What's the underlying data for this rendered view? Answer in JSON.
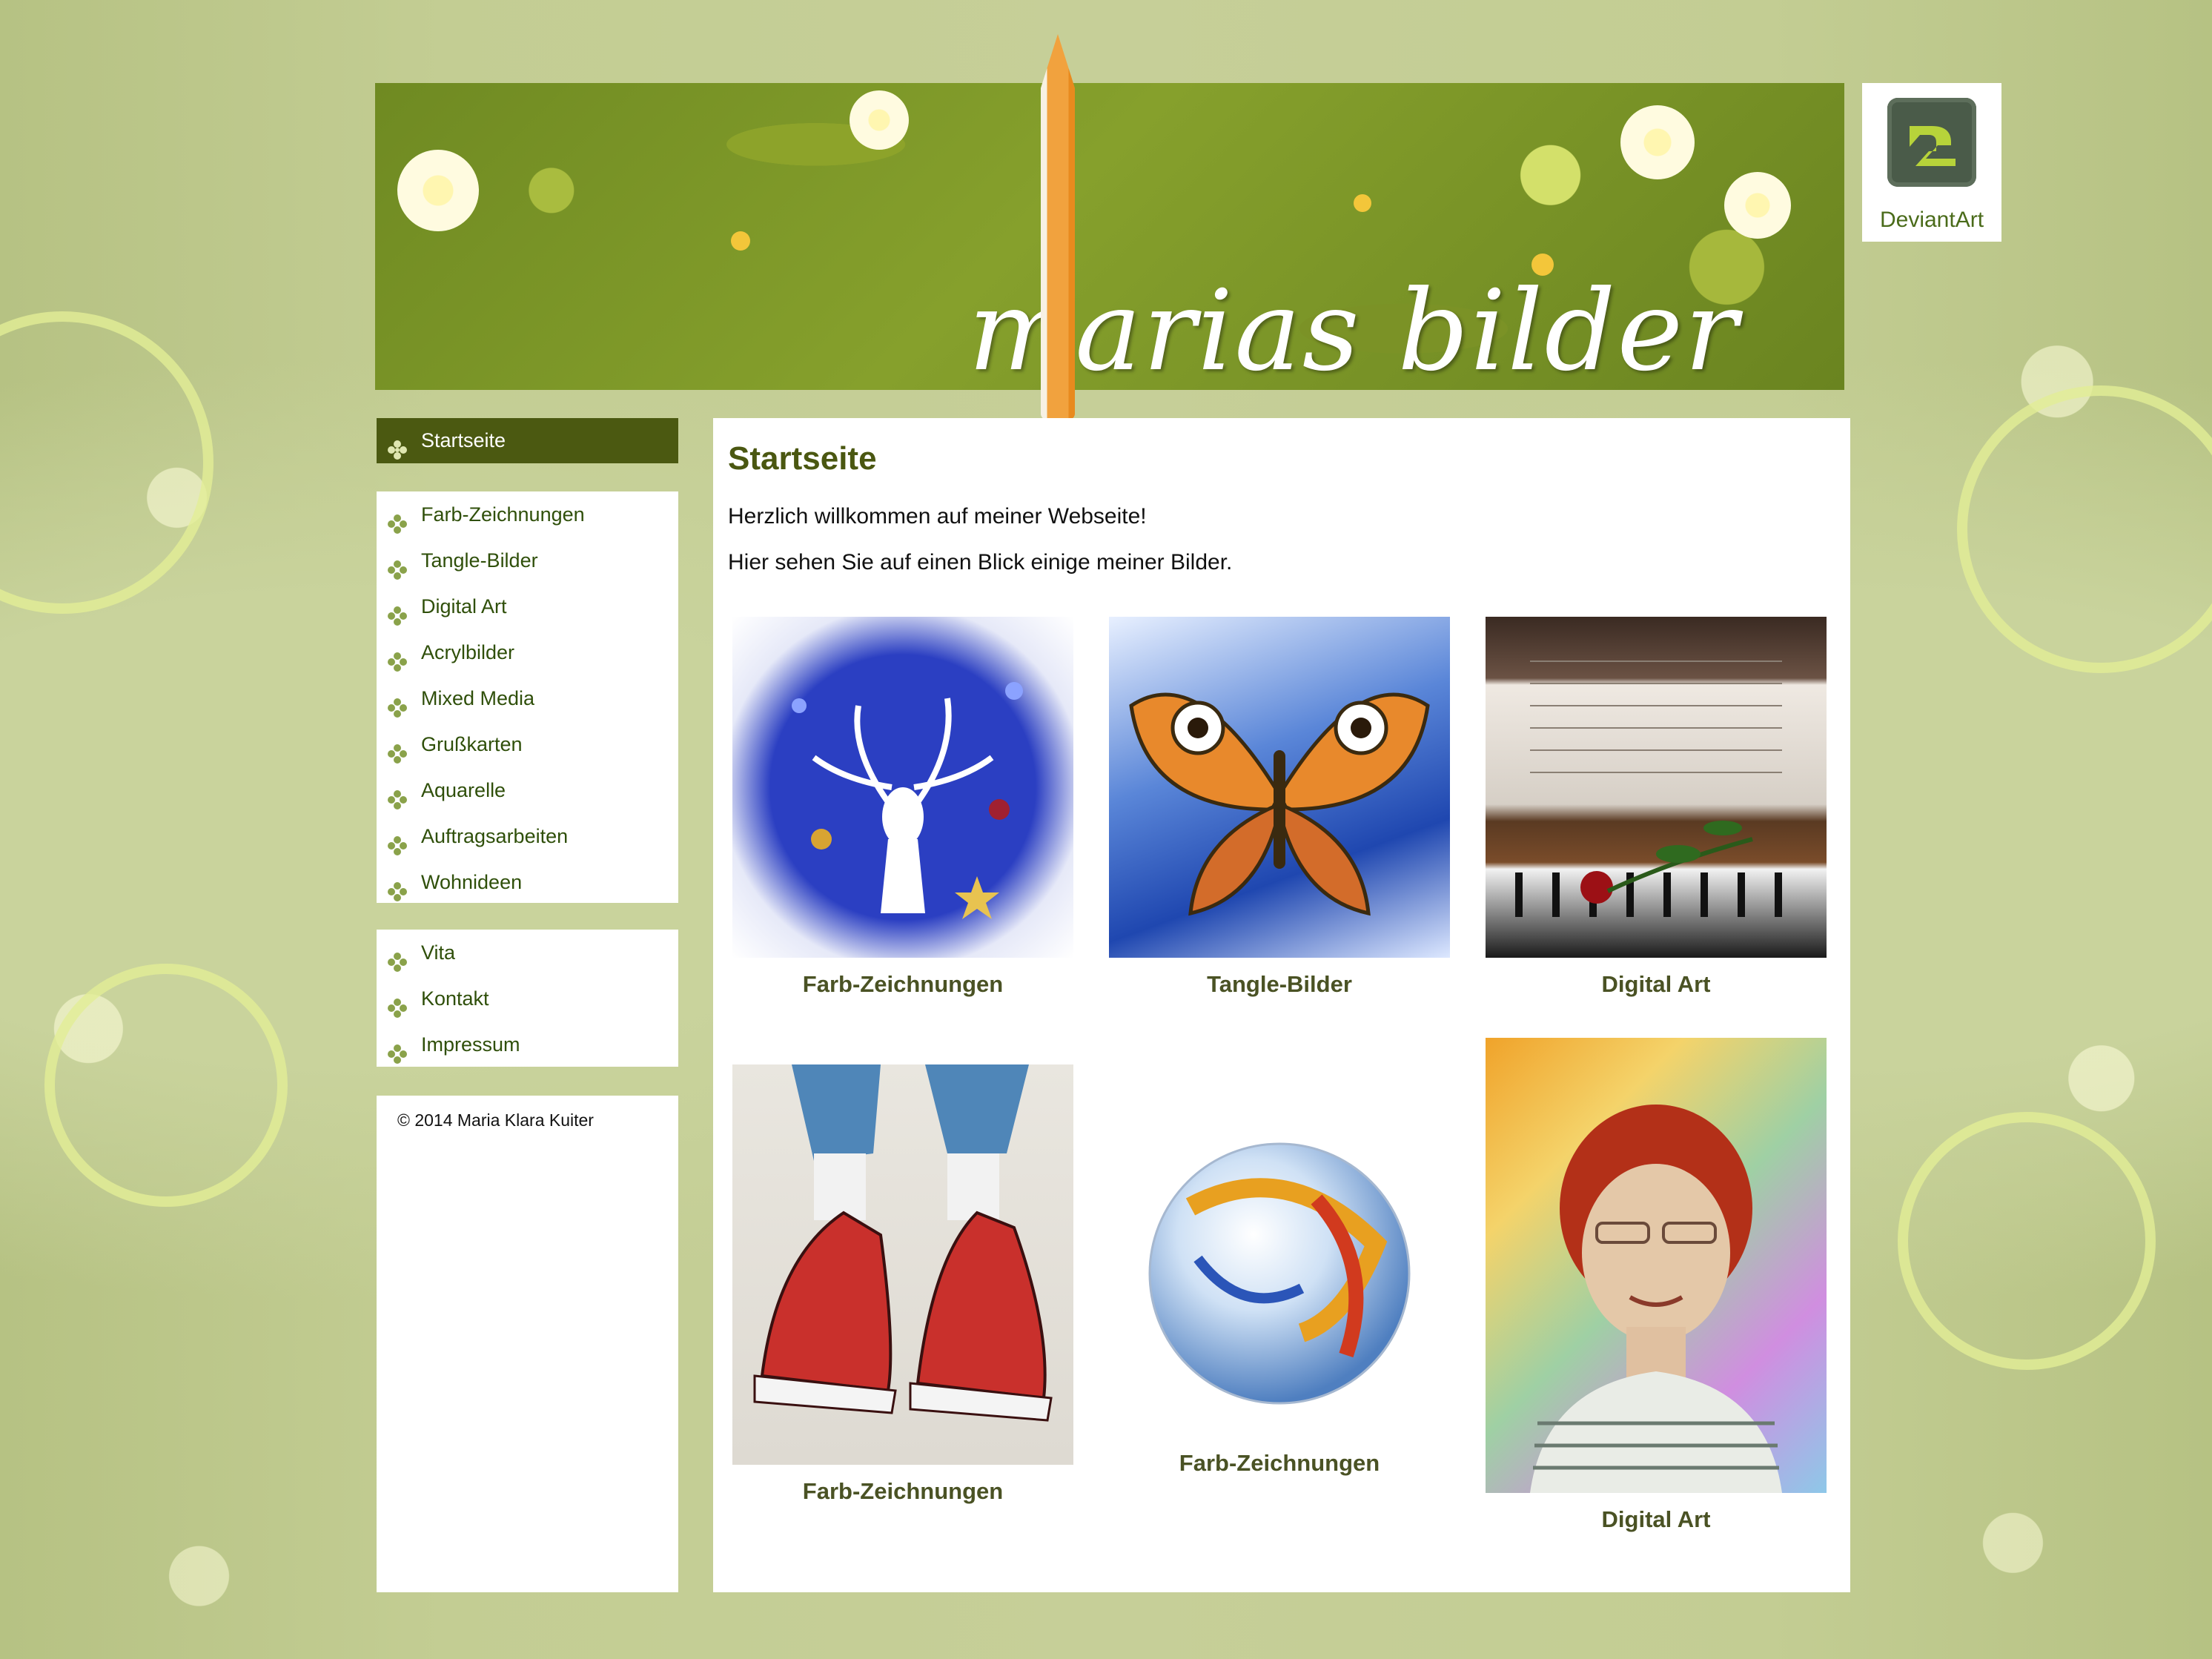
{
  "banner": {
    "title": "marias bilder"
  },
  "deviantart": {
    "label": "DeviantArt"
  },
  "nav": {
    "active": "Startseite",
    "gallery": [
      "Farb-Zeichnungen",
      "Tangle-Bilder",
      "Digital Art",
      "Acrylbilder",
      "Mixed Media",
      "Grußkarten",
      "Aquarelle",
      "Auftragsarbeiten",
      "Wohnideen"
    ],
    "info": [
      "Vita",
      "Kontakt",
      "Impressum"
    ]
  },
  "footer": {
    "copyright": "© 2014 Maria Klara Kuiter"
  },
  "main": {
    "title": "Startseite",
    "intro1": "Herzlich willkommen auf meiner Webseite!",
    "intro2": "Hier sehen Sie auf einen Blick einige meiner Bilder.",
    "tiles": [
      {
        "caption": "Farb-Zeichnungen"
      },
      {
        "caption": "Tangle-Bilder"
      },
      {
        "caption": "Digital Art"
      },
      {
        "caption": "Farb-Zeichnungen"
      },
      {
        "caption": "Farb-Zeichnungen"
      },
      {
        "caption": "Digital Art"
      }
    ]
  }
}
